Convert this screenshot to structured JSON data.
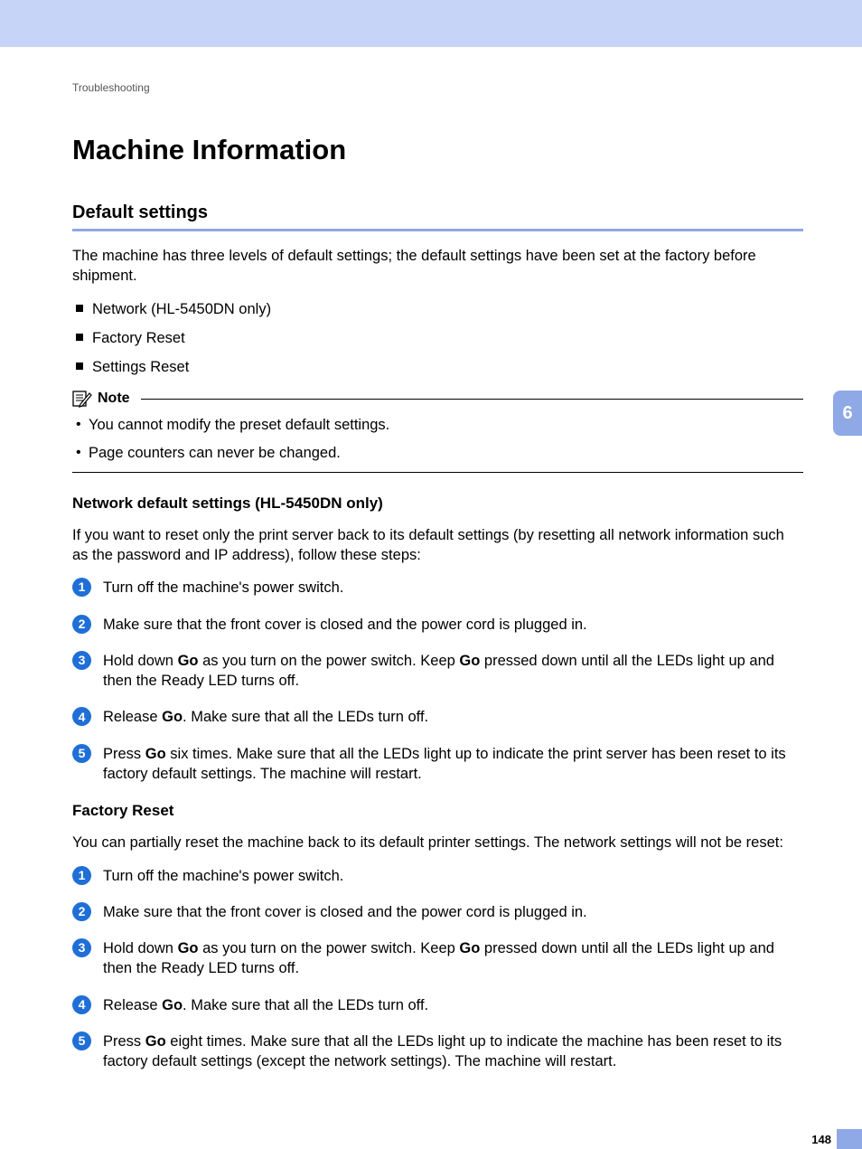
{
  "breadcrumb": "Troubleshooting",
  "h1": "Machine Information",
  "section1": {
    "title": "Default settings",
    "intro": "The machine has three levels of default settings; the default settings have been set at the factory before shipment.",
    "bullets": [
      "Network (HL-5450DN only)",
      "Factory Reset",
      "Settings Reset"
    ]
  },
  "note": {
    "label": "Note",
    "items": [
      "You cannot modify the preset default settings.",
      "Page counters can never be changed."
    ]
  },
  "sub1": {
    "title": "Network default settings (HL-5450DN only)",
    "intro": "If you want to reset only the print server back to its default settings (by resetting all network information such as the password and IP address), follow these steps:",
    "steps": [
      {
        "n": "1",
        "html": "Turn off the machine's power switch."
      },
      {
        "n": "2",
        "html": "Make sure that the front cover is closed and the power cord is plugged in."
      },
      {
        "n": "3",
        "html": "Hold down <strong>Go</strong> as you turn on the power switch. Keep <strong>Go</strong> pressed down until all the LEDs light up and then the Ready LED turns off."
      },
      {
        "n": "4",
        "html": "Release <strong>Go</strong>. Make sure that all the LEDs turn off."
      },
      {
        "n": "5",
        "html": "Press <strong>Go</strong> six times. Make sure that all the LEDs light up to indicate the print server has been reset to its factory default settings. The machine will restart."
      }
    ]
  },
  "sub2": {
    "title": "Factory Reset",
    "intro": "You can partially reset the machine back to its default printer settings. The network settings will not be reset:",
    "steps": [
      {
        "n": "1",
        "html": "Turn off the machine's power switch."
      },
      {
        "n": "2",
        "html": "Make sure that the front cover is closed and the power cord is plugged in."
      },
      {
        "n": "3",
        "html": "Hold down <strong>Go</strong> as you turn on the power switch. Keep <strong>Go</strong> pressed down until all the LEDs light up and then the Ready LED turns off."
      },
      {
        "n": "4",
        "html": "Release <strong>Go</strong>. Make sure that all the LEDs turn off."
      },
      {
        "n": "5",
        "html": "Press <strong>Go</strong> eight times. Make sure that all the LEDs light up to indicate the machine has been reset to its factory default settings (except the network settings). The machine will restart."
      }
    ]
  },
  "sideTab": "6",
  "pageNumber": "148"
}
